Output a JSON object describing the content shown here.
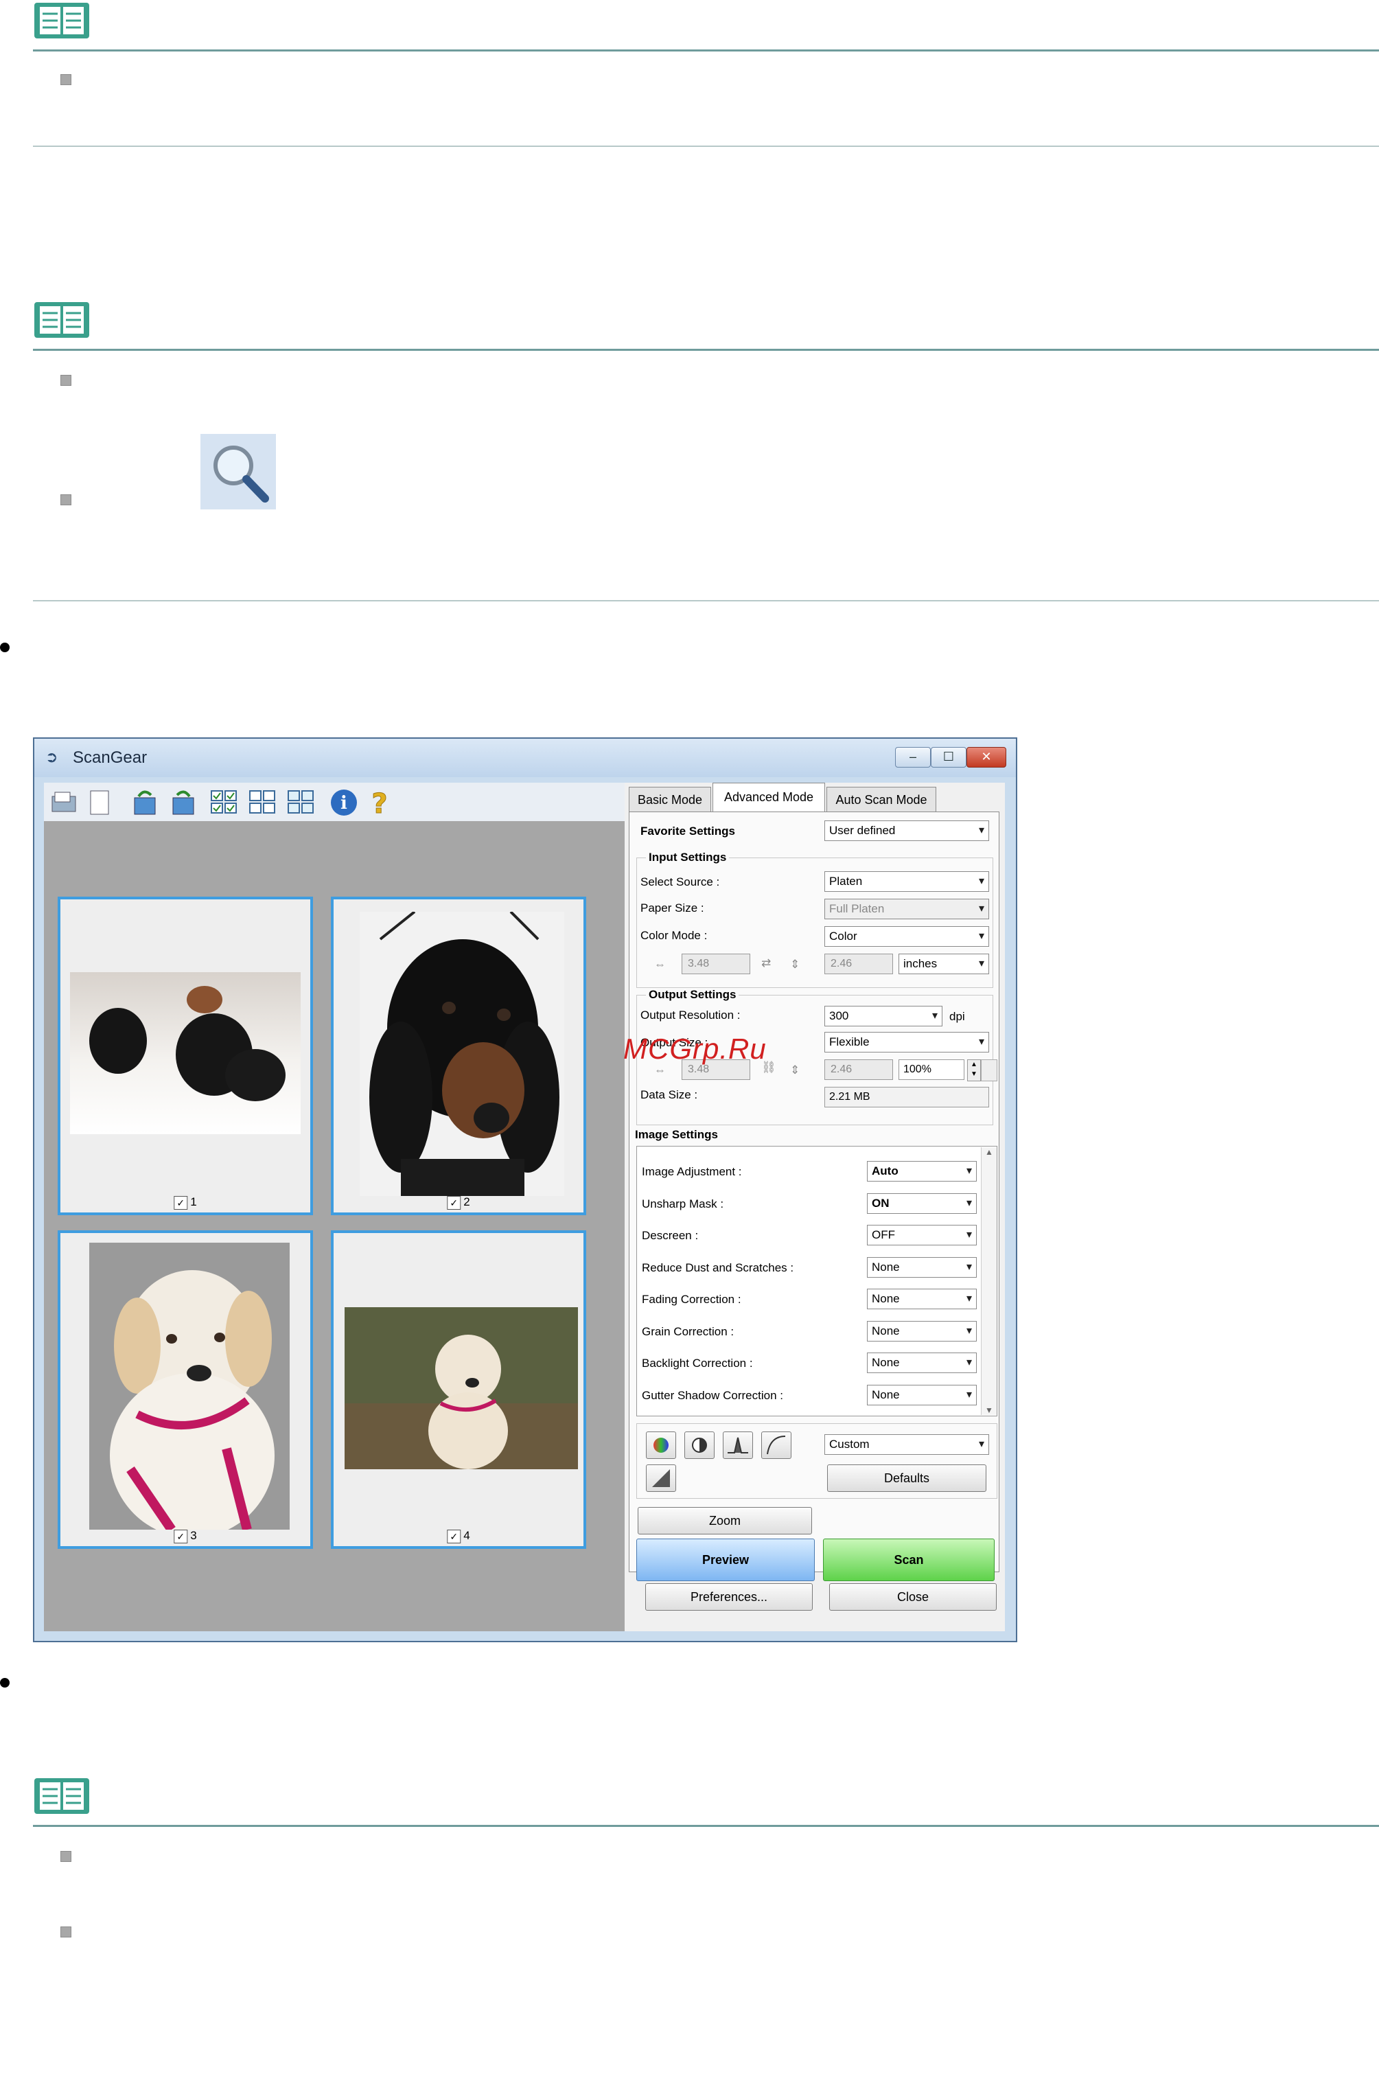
{
  "window": {
    "title": "ScanGear",
    "controls": {
      "minimize": "–",
      "maximize": "☐",
      "close": "✕"
    }
  },
  "toolbar_icons": [
    "scan-source-icon",
    "blank-page-icon",
    "rotate-left-icon",
    "rotate-right-icon",
    "thumbnail-view-large-icon",
    "thumbnail-view-medium-icon",
    "thumbnail-view-small-icon",
    "info-icon",
    "help-icon"
  ],
  "thumbnails": [
    {
      "label": "1",
      "checked": true
    },
    {
      "label": "2",
      "checked": true
    },
    {
      "label": "3",
      "checked": true
    },
    {
      "label": "4",
      "checked": true
    }
  ],
  "tabs": [
    "Basic Mode",
    "Advanced Mode",
    "Auto Scan Mode"
  ],
  "favorite": {
    "label": "Favorite Settings",
    "value": "User defined"
  },
  "input": {
    "heading": "Input Settings",
    "source_label": "Select Source :",
    "source_value": "Platen",
    "paper_label": "Paper Size :",
    "paper_value": "Full Platen",
    "color_label": "Color Mode :",
    "color_value": "Color",
    "width": "3.48",
    "height": "2.46",
    "unit": "inches"
  },
  "output": {
    "heading": "Output Settings",
    "resolution_label": "Output Resolution :",
    "resolution_value": "300",
    "resolution_unit": "dpi",
    "size_label": "Output Size :",
    "size_value": "Flexible",
    "width": "3.48",
    "height": "2.46",
    "scale": "100%",
    "datasize_label": "Data Size :",
    "datasize_value": "2.21 MB"
  },
  "image_settings": {
    "heading": "Image Settings",
    "rows": [
      {
        "label": "Image Adjustment :",
        "value": "Auto"
      },
      {
        "label": "Unsharp Mask :",
        "value": "ON"
      },
      {
        "label": "Descreen :",
        "value": "OFF"
      },
      {
        "label": "Reduce Dust and Scratches :",
        "value": "None"
      },
      {
        "label": "Fading Correction :",
        "value": "None"
      },
      {
        "label": "Grain Correction :",
        "value": "None"
      },
      {
        "label": "Backlight Correction :",
        "value": "None"
      },
      {
        "label": "Gutter Shadow Correction :",
        "value": "None"
      }
    ]
  },
  "color_tools": {
    "preset": "Custom",
    "defaults": "Defaults"
  },
  "buttons": {
    "zoom": "Zoom",
    "preview": "Preview",
    "scan": "Scan",
    "preferences": "Preferences...",
    "close": "Close"
  },
  "watermark": "MCGrp.Ru"
}
